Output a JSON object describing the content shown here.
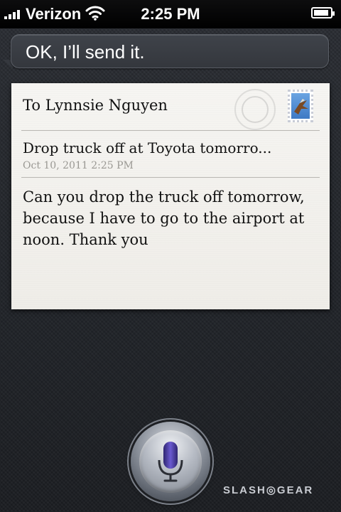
{
  "status_bar": {
    "carrier": "Verizon",
    "time": "2:25 PM",
    "signal_bars": 4,
    "wifi_icon": "wifi-icon",
    "battery_level": 0.92
  },
  "siri": {
    "response": "OK, I’ll send it."
  },
  "email": {
    "to": "To Lynnsie Nguyen",
    "subject": "Drop truck off at Toyota tomorro...",
    "date": "Oct 10, 2011 2:25 PM",
    "body": "Can you drop the truck off tomorrow, because I have to go to the airport at noon. Thank you",
    "stamp_icon": "mail-stamp-icon"
  },
  "mic": {
    "icon": "microphone-icon",
    "accent_color": "#4b3ea0"
  },
  "watermark": "SLASH◎GEAR"
}
